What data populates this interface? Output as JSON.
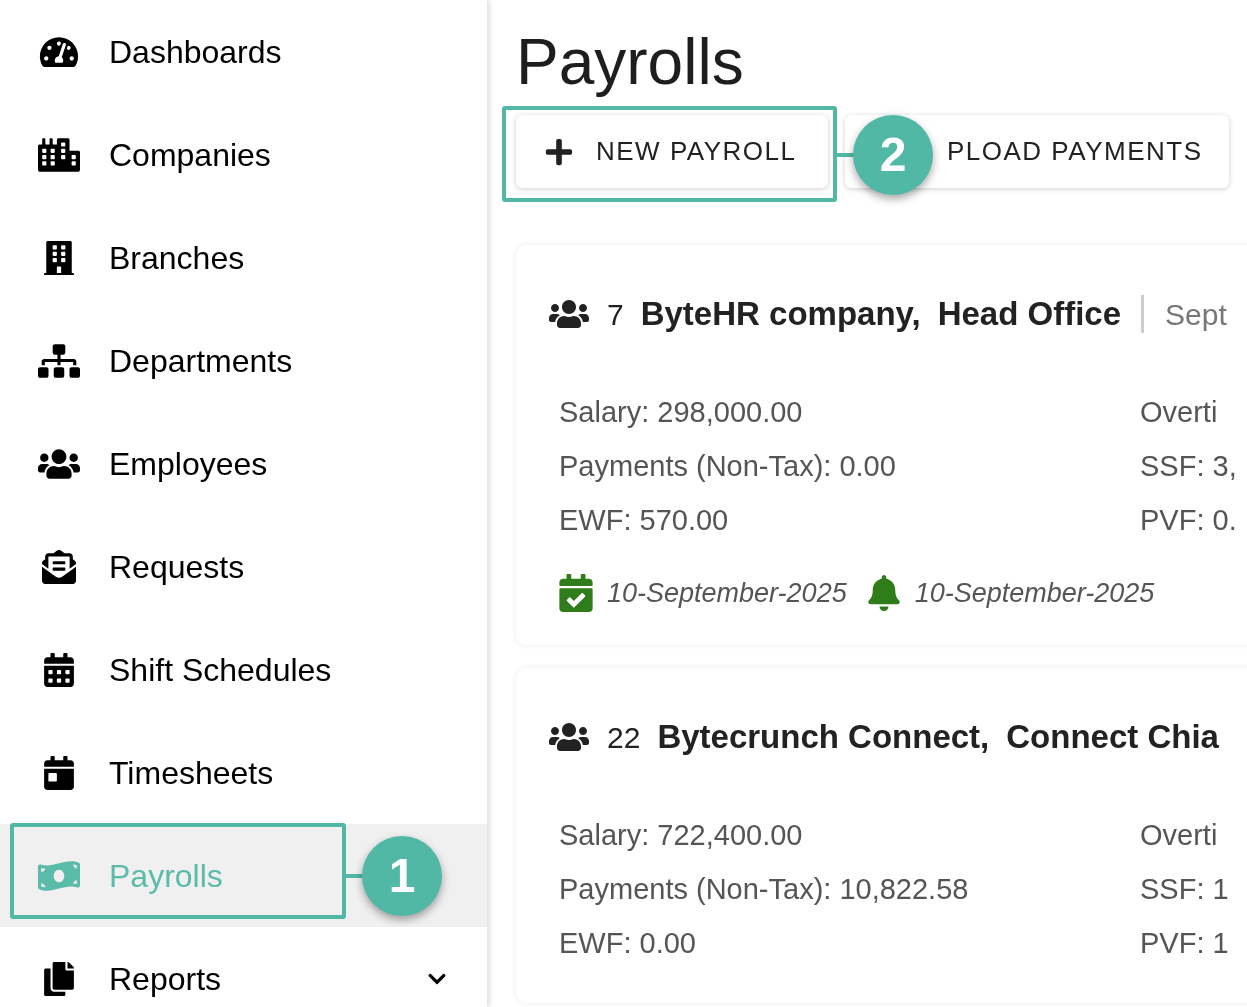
{
  "sidebar": {
    "items": [
      {
        "label": "Dashboards",
        "selected": false
      },
      {
        "label": "Companies",
        "selected": false
      },
      {
        "label": "Branches",
        "selected": false
      },
      {
        "label": "Departments",
        "selected": false
      },
      {
        "label": "Employees",
        "selected": false
      },
      {
        "label": "Requests",
        "selected": false
      },
      {
        "label": "Shift Schedules",
        "selected": false
      },
      {
        "label": "Timesheets",
        "selected": false
      },
      {
        "label": "Payrolls",
        "selected": true
      },
      {
        "label": "Reports",
        "selected": false,
        "expanded": false
      }
    ]
  },
  "page": {
    "title": "Payrolls",
    "buttons": [
      {
        "label": "NEW PAYROLL",
        "kind": "add"
      },
      {
        "label": "PLOAD PAYMENTS",
        "kind": "plain"
      }
    ],
    "cards": [
      {
        "count": "7",
        "company": "ByteHR company,",
        "branch": "Head Office",
        "period": "Sept",
        "left": [
          "Salary: 298,000.00",
          "Payments (Non-Tax): 0.00",
          "EWF: 570.00"
        ],
        "right": [
          "Overti",
          "SSF: 3,",
          "PVF: 0."
        ],
        "dates": [
          {
            "kind": "calendar",
            "text": "10-September-2025"
          },
          {
            "kind": "bell",
            "text": "10-September-2025"
          }
        ]
      },
      {
        "count": "22",
        "company": "Bytecrunch Connect,",
        "branch": "Connect Chia",
        "left": [
          "Salary: 722,400.00",
          "Payments (Non-Tax): 10,822.58",
          "EWF: 0.00"
        ],
        "right": [
          "Overti",
          "SSF: 1",
          "PVF: 1"
        ]
      }
    ]
  },
  "annotations": [
    {
      "number": "1"
    },
    {
      "number": "2"
    }
  ]
}
